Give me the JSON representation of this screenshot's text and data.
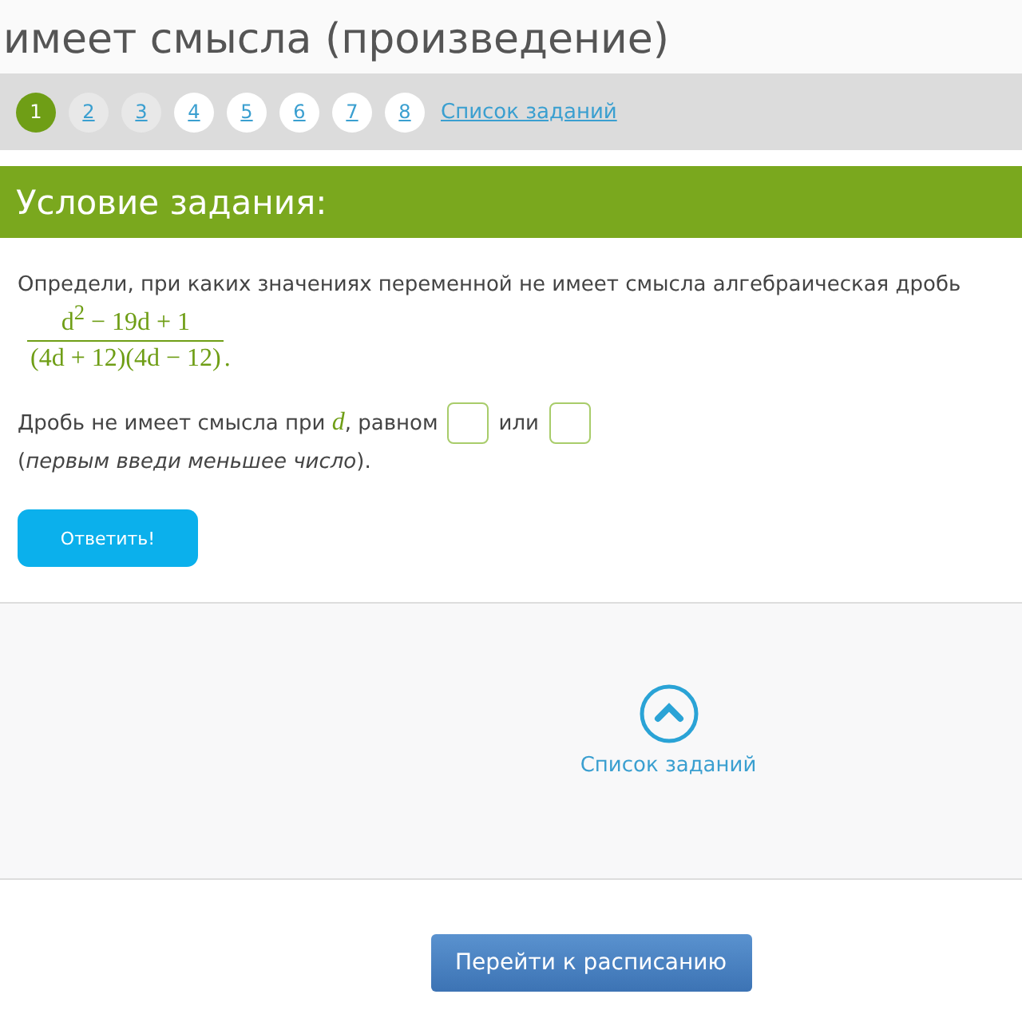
{
  "page_title": "имеет смысла (произведение)",
  "pager": {
    "items": [
      {
        "label": "1",
        "selected": true,
        "visited": true
      },
      {
        "label": "2",
        "selected": false,
        "visited": true
      },
      {
        "label": "3",
        "selected": false,
        "visited": true
      },
      {
        "label": "4",
        "selected": false,
        "visited": false
      },
      {
        "label": "5",
        "selected": false,
        "visited": false
      },
      {
        "label": "6",
        "selected": false,
        "visited": false
      },
      {
        "label": "7",
        "selected": false,
        "visited": false
      },
      {
        "label": "8",
        "selected": false,
        "visited": false
      }
    ],
    "list_link": "Список заданий"
  },
  "task_header": "Условие задания:",
  "question": "Определи, при каких значениях переменной не имеет смысла алгебраическая дробь",
  "fraction": {
    "numerator": "d$^{2}$ − 19d + 1",
    "denominator": "(4d + 12)(4d − 12)",
    "trailing": "."
  },
  "answer_line": {
    "before": "Дробь не имеет смысла при",
    "variable": "d",
    "after": ", равном",
    "joiner": "или"
  },
  "hint": "(*первым введи меньшее число*).",
  "submit_button": "Ответить!",
  "task_list_link": "Список заданий",
  "schedule_button": "Перейти к расписанию"
}
